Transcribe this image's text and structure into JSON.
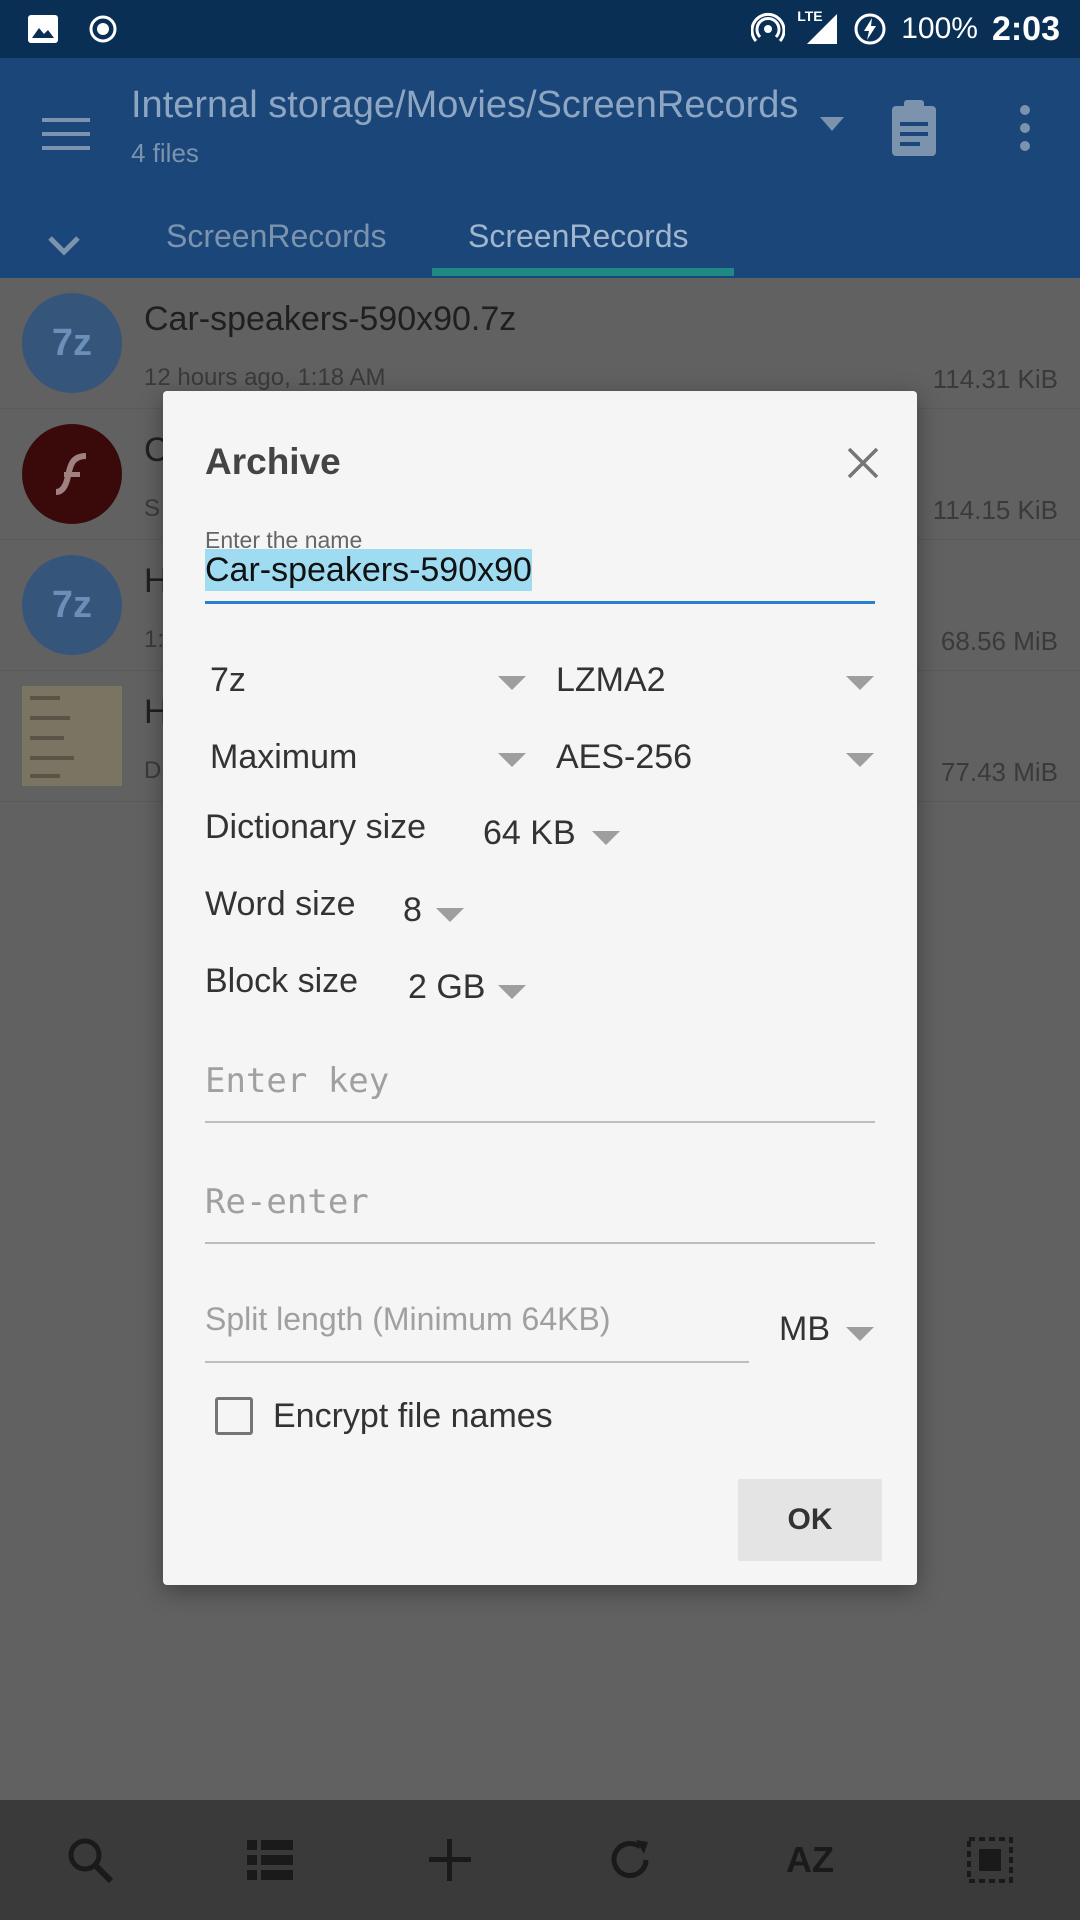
{
  "status_bar": {
    "battery": "100%",
    "time": "2:03",
    "network": "LTE"
  },
  "app_bar": {
    "path": "Internal storage/Movies/ScreenRecords",
    "file_count": "4 files",
    "tabs": [
      {
        "label": "ScreenRecords"
      },
      {
        "label": "ScreenRecords"
      }
    ]
  },
  "files": [
    {
      "name": "Car-speakers-590x90.7z",
      "date": "12 hours ago, 1:18 AM",
      "size": "114.31 KiB",
      "icon": "7z"
    },
    {
      "name": "C",
      "date": "S",
      "size": "114.15 KiB",
      "icon": "flash"
    },
    {
      "name": "H",
      "date": "1:",
      "size": "68.56 MiB",
      "icon": "7z"
    },
    {
      "name": "H",
      "date": "D",
      "size": "77.43 MiB",
      "icon": "thumb"
    }
  ],
  "dialog": {
    "title": "Archive",
    "name_label": "Enter the name",
    "name_value": "Car-speakers-590x90",
    "format": "7z",
    "method": "LZMA2",
    "level": "Maximum",
    "encryption": "AES-256",
    "dictionary_label": "Dictionary size",
    "dictionary_value": "64 KB",
    "word_label": "Word size",
    "word_value": "8",
    "block_label": "Block size",
    "block_value": "2 GB",
    "key_placeholder": "Enter key",
    "reenter_placeholder": "Re-enter",
    "split_placeholder": "Split length (Minimum 64KB)",
    "split_unit": "MB",
    "encrypt_names_label": "Encrypt file names",
    "ok_label": "OK"
  },
  "bottom_bar": {
    "sort_label": "AZ"
  }
}
